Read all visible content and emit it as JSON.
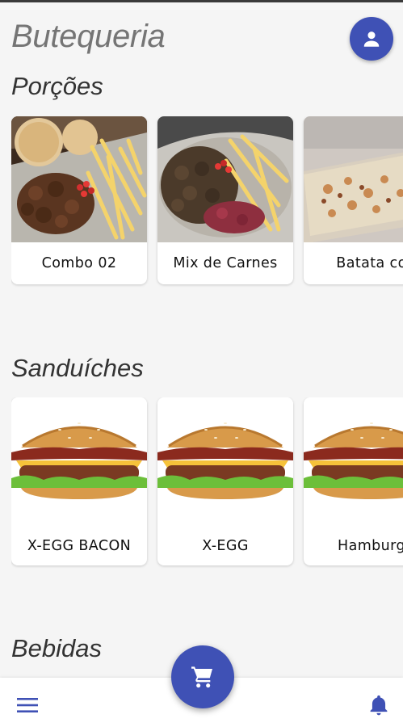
{
  "app": {
    "title": "Butequeria"
  },
  "sections": [
    {
      "title": "Porções",
      "items": [
        {
          "label": "Combo 02"
        },
        {
          "label": "Mix de Carnes"
        },
        {
          "label": "Batata co"
        }
      ]
    },
    {
      "title": "Sanduíches",
      "items": [
        {
          "label": "X-EGG BACON"
        },
        {
          "label": "X-EGG"
        },
        {
          "label": "Hamburg"
        }
      ]
    },
    {
      "title": "Bebidas",
      "items": []
    }
  ],
  "icons": {
    "profile": "person-icon",
    "menu": "hamburger-menu-icon",
    "cart": "shopping-cart-icon",
    "notifications": "bell-icon"
  },
  "colors": {
    "primary": "#3f51b5",
    "background": "#f5f5f5"
  }
}
